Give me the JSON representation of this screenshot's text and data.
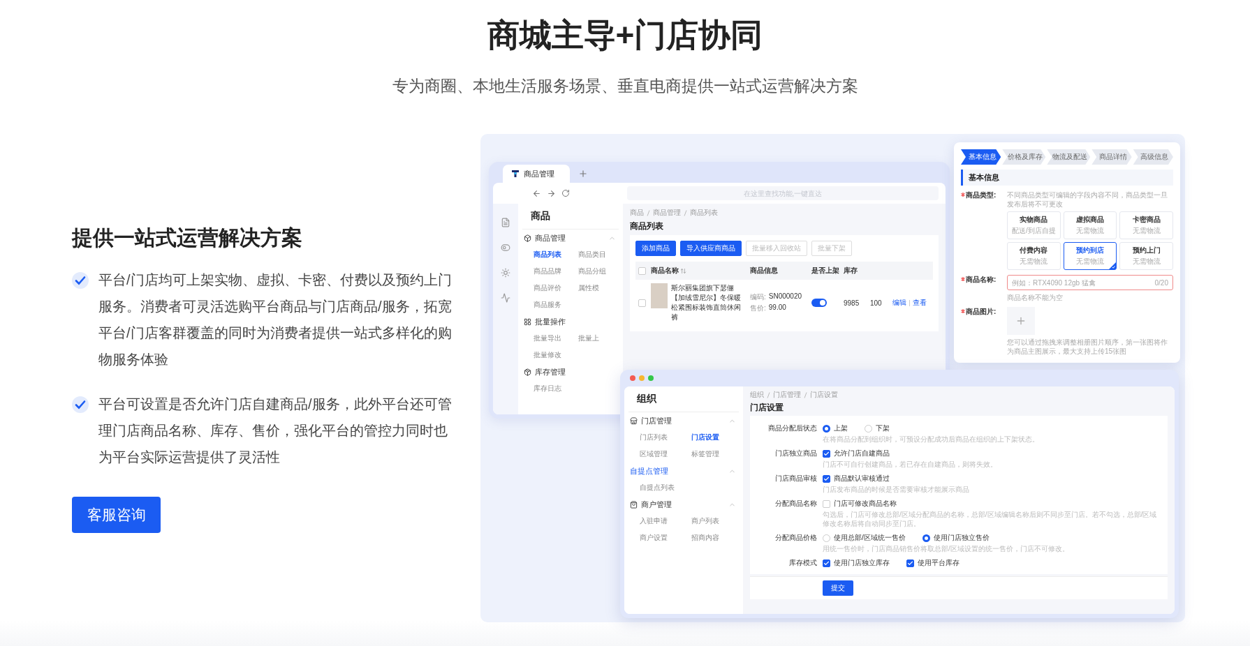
{
  "header": {
    "title": "商城主导+门店协同",
    "subtitle": "专为商圈、本地生活服务场景、垂直电商提供一站式运营解决方案"
  },
  "intro": {
    "heading": "提供一站式运营解决方案",
    "points": [
      "平台/门店均可上架实物、虚拟、卡密、付费以及预约上门服务。消费者可灵活选购平台商品与门店商品/服务，拓宽平台/门店客群覆盖的同时为消费者提供一站式多样化的购物服务体验",
      "平台可设置是否允许门店自建商品/服务，此外平台还可管理门店商品名称、库存、售价，强化平台的管控力同时也为平台实际运营提供了灵活性"
    ],
    "button": "客服咨询"
  },
  "product_window": {
    "tab": "商品管理",
    "search": {
      "placeholder": "在这里查找功能,一键直达"
    },
    "sidebar": {
      "title": "商品",
      "groups": [
        {
          "label": "商品管理",
          "kind": "box",
          "expanded": true,
          "items": [
            {
              "label": "商品列表",
              "selected": true
            },
            {
              "label": "商品类目",
              "selected": false
            },
            {
              "label": "商品品牌",
              "selected": false
            },
            {
              "label": "商品分组",
              "selected": false
            },
            {
              "label": "商品评价",
              "selected": false
            },
            {
              "label": "属性模",
              "selected": false
            },
            {
              "label": "商品服务",
              "selected": false
            }
          ]
        },
        {
          "label": "批量操作",
          "kind": "grid",
          "items": [
            {
              "label": "批量导出",
              "selected": false
            },
            {
              "label": "批量上",
              "selected": false
            },
            {
              "label": "批量修改",
              "selected": false
            }
          ]
        },
        {
          "label": "库存管理",
          "kind": "stock",
          "items": [
            {
              "label": "库存日志",
              "selected": false
            }
          ]
        }
      ]
    },
    "breadcrumb": [
      "商品",
      "商品管理",
      "商品列表"
    ],
    "title": "商品列表",
    "actions": [
      {
        "label": "添加商品",
        "kind": "primary"
      },
      {
        "label": "导入供应商商品",
        "kind": "primary"
      },
      {
        "label": "批量移入回收站",
        "kind": "disabled"
      },
      {
        "label": "批量下架",
        "kind": "disabled"
      }
    ],
    "table": {
      "select_all": false,
      "columns": [
        "商品名称",
        "商品信息",
        "是否上架",
        "库存"
      ],
      "rows": [
        {
          "checked": false,
          "name": "斯尔丽集团旗下瑟俪【加绒雪尼尔】冬保暖松紧围标装饰直筒休闲裤",
          "info": [
            {
              "label": "编码:",
              "value": "SN000020"
            },
            {
              "label": "售价:",
              "value": "99.00"
            }
          ],
          "on_shelf": true,
          "stock": "9985",
          "column_6": "100",
          "actions": [
            "编辑",
            "查看"
          ]
        }
      ]
    }
  },
  "form_card": {
    "steps": [
      {
        "label": "基本信息",
        "selected": true
      },
      {
        "label": "价格及库存",
        "selected": false
      },
      {
        "label": "物流及配送",
        "selected": false
      },
      {
        "label": "商品详情",
        "selected": false
      },
      {
        "label": "高级信息",
        "selected": false
      }
    ],
    "section": "基本信息",
    "type_field": {
      "label": "商品类型:",
      "required": true,
      "hint": "不同商品类型可编辑的字段内容不同，商品类型一旦发布后将不可更改",
      "options": [
        {
          "title": "实物商品",
          "subtitle": "配送/到店自提",
          "selected": false
        },
        {
          "title": "虚拟商品",
          "subtitle": "无需物流",
          "selected": false
        },
        {
          "title": "卡密商品",
          "subtitle": "无需物流",
          "selected": false
        },
        {
          "title": "付费内容",
          "subtitle": "无需物流",
          "selected": false
        },
        {
          "title": "预约到店",
          "subtitle": "无需物流",
          "selected": true
        },
        {
          "title": "预约上门",
          "subtitle": "无需物流",
          "selected": false
        }
      ]
    },
    "name_field": {
      "label": "商品名称:",
      "required": true,
      "placeholder": "例如：RTX4090 12gb 猛禽",
      "counter": "0/20",
      "error": "商品名称不能为空"
    },
    "image_field": {
      "label": "商品图片:",
      "required": true,
      "hint": "您可以通过拖拽来调整相册图片顺序，第一张图将作为商品主图展示，最大支持上传15张图"
    }
  },
  "store_window": {
    "sidebar": {
      "title": "组织",
      "groups": [
        {
          "label": "门店管理",
          "kind": "store",
          "selected": false,
          "expanded": true,
          "items": [
            {
              "label": "门店列表",
              "selected": false
            },
            {
              "label": "门店设置",
              "selected": true
            },
            {
              "label": "区域管理",
              "selected": false
            },
            {
              "label": "标签管理",
              "selected": false
            }
          ]
        },
        {
          "label": "自提点管理",
          "kind": "plain",
          "selected": true,
          "expanded": true,
          "items": [
            {
              "label": "自提点列表",
              "selected": false
            }
          ]
        },
        {
          "label": "商户管理",
          "kind": "bag",
          "selected": false,
          "expanded": true,
          "items": [
            {
              "label": "入驻申请",
              "selected": false
            },
            {
              "label": "商户列表",
              "selected": false
            },
            {
              "label": "商户设置",
              "selected": false
            },
            {
              "label": "招商内容",
              "selected": false
            }
          ]
        }
      ]
    },
    "breadcrumb": [
      "组织",
      "门店管理",
      "门店设置"
    ],
    "title": "门店设置",
    "rows": [
      {
        "label": "商品分配后状态",
        "kind": "radio",
        "options": [
          {
            "label": "上架",
            "selected": true
          },
          {
            "label": "下架",
            "selected": false
          }
        ],
        "hint": "在将商品分配到组织时，可预设分配成功后商品在组织的上下架状态。"
      },
      {
        "label": "门店独立商品",
        "kind": "checkbox",
        "options": [
          {
            "label": "允许门店自建商品",
            "selected": true
          }
        ],
        "hint": "门店不可自行创建商品，若已存在自建商品，则将失效。"
      },
      {
        "label": "门店商品审核",
        "kind": "checkbox",
        "options": [
          {
            "label": "商品默认审核通过",
            "selected": true
          }
        ],
        "hint": "门店发布商品的时候是否需要审核才能展示商品"
      },
      {
        "label": "分配商品名称",
        "kind": "checkbox",
        "options": [
          {
            "label": "门店可修改商品名称",
            "selected": false
          }
        ],
        "hint": "勾选后，门店可修改总部/区域分配商品的名称，总部/区域编辑名称后则不同步至门店。若不勾选，总部/区域修改名称后将自动同步至门店。"
      },
      {
        "label": "分配商品价格",
        "kind": "radio",
        "options": [
          {
            "label": "使用总部/区域统一售价",
            "selected": false
          },
          {
            "label": "使用门店独立售价",
            "selected": true
          }
        ],
        "hint": "用统一售价时，门店商品销售价将取总部/区域设置的统一售价，门店不可修改。"
      },
      {
        "label": "库存模式",
        "kind": "checkbox",
        "options": [
          {
            "label": "使用门店独立库存",
            "selected": true
          },
          {
            "label": "使用平台库存",
            "selected": true
          }
        ]
      }
    ],
    "submit": "提交"
  }
}
